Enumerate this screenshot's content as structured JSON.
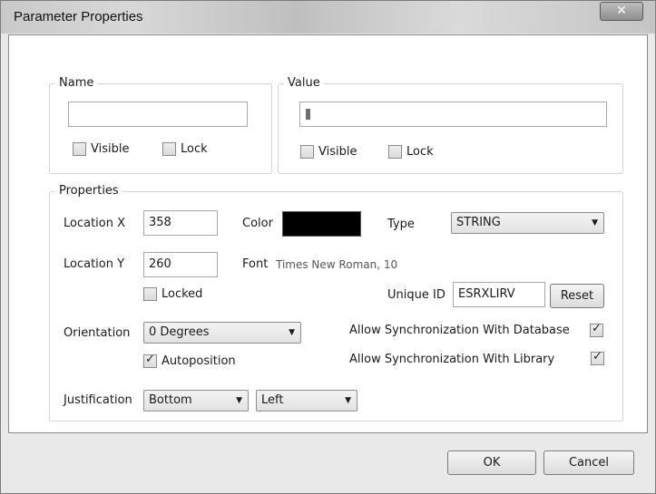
{
  "window": {
    "title": "Parameter Properties",
    "close_icon": "close-icon"
  },
  "name_group": {
    "legend": "Name",
    "value": "",
    "visible_label": "Visible",
    "lock_label": "Lock",
    "visible": false,
    "lock": false
  },
  "value_group": {
    "legend": "Value",
    "value": "",
    "visible_label": "Visible",
    "lock_label": "Lock",
    "visible": false,
    "lock": false
  },
  "properties": {
    "legend": "Properties",
    "location_x_label": "Location  X",
    "location_x": "358",
    "location_y_label": "Location  Y",
    "location_y": "260",
    "color_label": "Color",
    "color_value": "#000000",
    "type_label": "Type",
    "type_value": "STRING",
    "font_label": "Font",
    "font_value": "Times New Roman, 10",
    "locked_label": "Locked",
    "locked": false,
    "unique_id_label": "Unique ID",
    "unique_id": "ESRXLIRV",
    "reset_label": "Reset",
    "orientation_label": "Orientation",
    "orientation_value": "0 Degrees",
    "autoposition_label": "Autoposition",
    "autoposition": true,
    "sync_db_label": "Allow Synchronization With Database",
    "sync_db": true,
    "sync_lib_label": "Allow Synchronization With Library",
    "sync_lib": true,
    "justification_label": "Justification",
    "justification_v": "Bottom",
    "justification_h": "Left"
  },
  "buttons": {
    "ok": "OK",
    "cancel": "Cancel"
  }
}
